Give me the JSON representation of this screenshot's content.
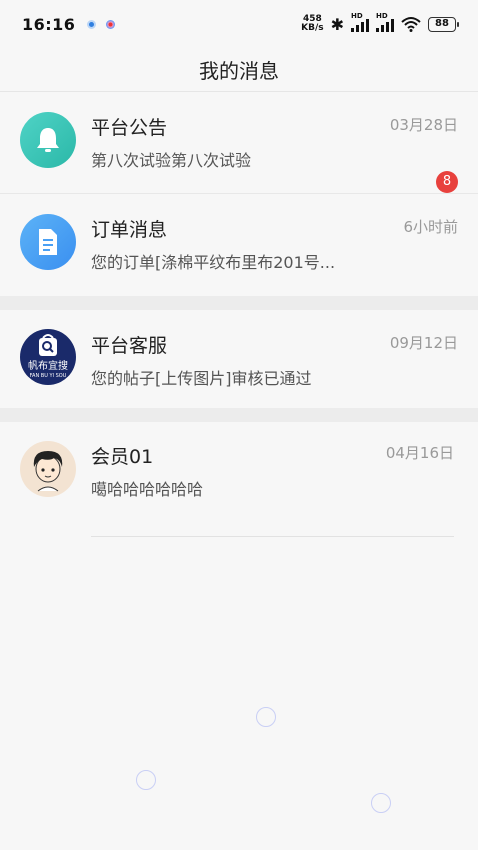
{
  "status_bar": {
    "time": "16:16",
    "net_speed_value": "458",
    "net_speed_unit": "KB/s",
    "battery": "88",
    "hd_label": "HD"
  },
  "header": {
    "title": "我的消息"
  },
  "messages": [
    {
      "name": "平台公告",
      "time": "03月28日",
      "preview": "第八次试验第八次试验",
      "icon": "bell-icon",
      "color": "#35c4b5"
    },
    {
      "name": "订单消息",
      "time": "6小时前",
      "preview": "您的订单[涤棉平纹布里布201号...",
      "icon": "document-icon",
      "color": "#4aa0f4",
      "badge": "8"
    },
    {
      "name": "平台客服",
      "time": "09月12日",
      "preview": "您的帖子[上传图片]审核已通过",
      "icon": "search-bag-logo",
      "logo_text": "帆布宜搜",
      "logo_subtext": "FAN BU YI SOU",
      "color": "#1a2a6a"
    },
    {
      "name": "会员01",
      "time": "04月16日",
      "preview": "噶哈哈哈哈哈哈",
      "icon": "user-avatar"
    }
  ],
  "colors": {
    "badge": "#e8413d",
    "accent": "#4aa0f4"
  }
}
